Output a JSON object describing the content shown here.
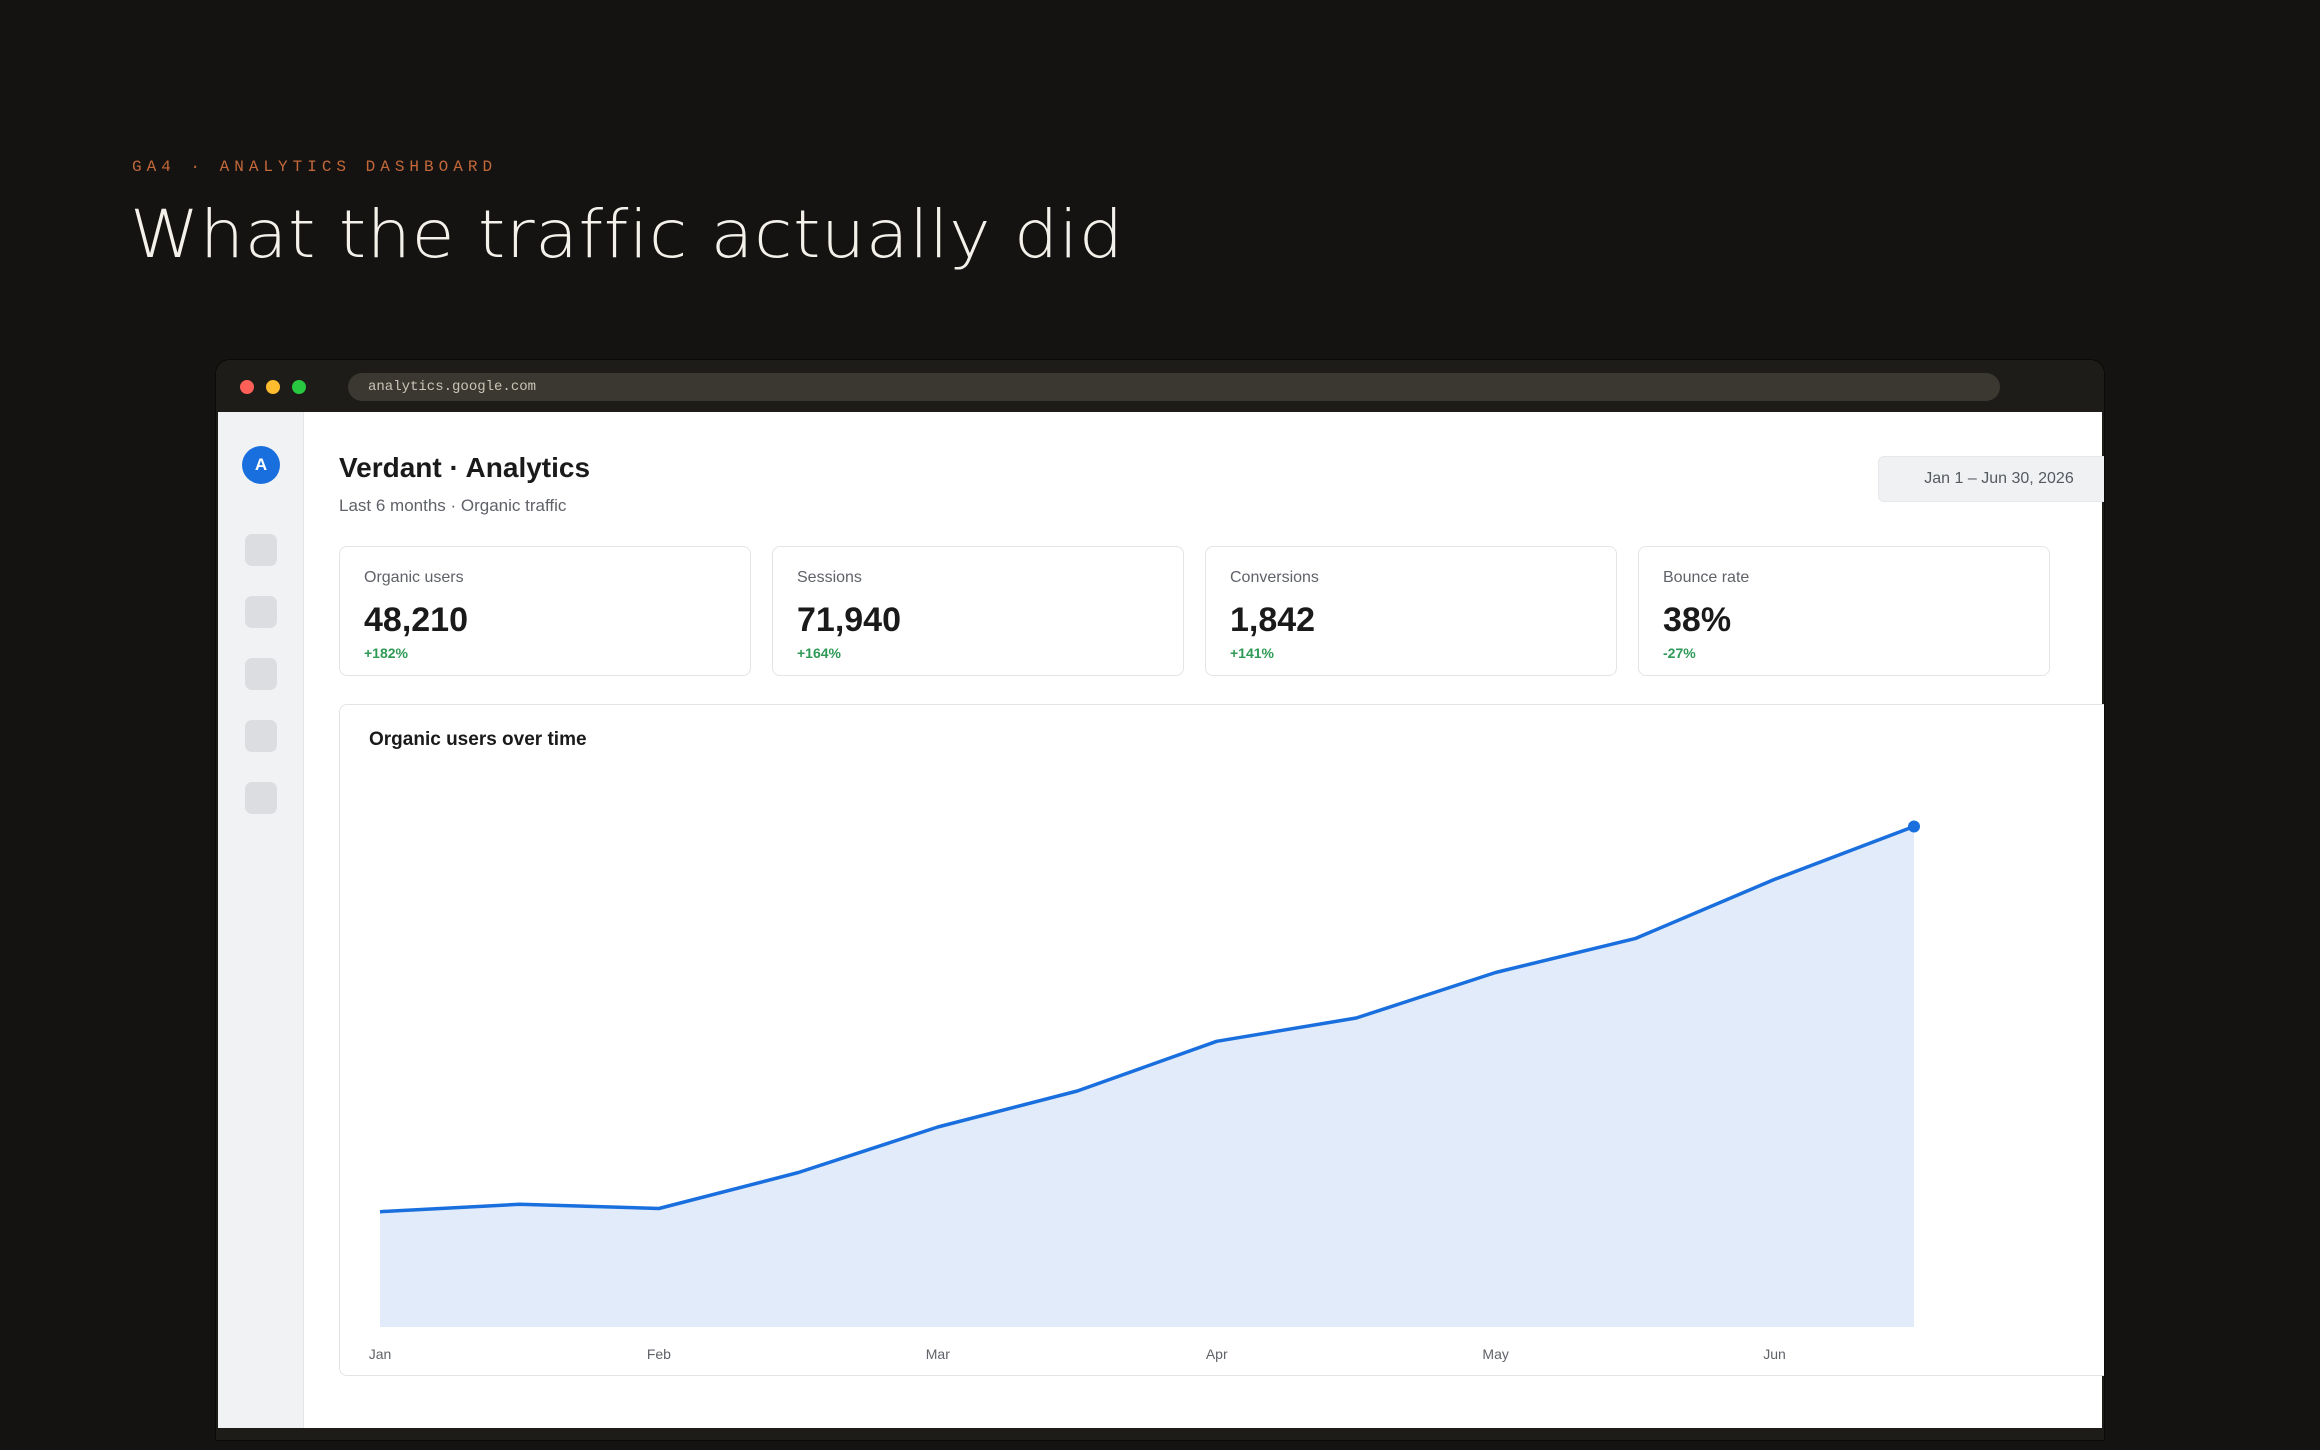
{
  "page": {
    "eyebrow": "GA4 · ANALYTICS DASHBOARD",
    "headline": "What the traffic actually did"
  },
  "browser": {
    "url": "analytics.google.com"
  },
  "sidebar": {
    "avatar_initial": "A"
  },
  "header": {
    "title": "Verdant · Analytics",
    "subtitle": "Last 6 months · Organic traffic",
    "date_range": "Jan 1 – Jun 30, 2026"
  },
  "kpis": [
    {
      "label": "Organic users",
      "value": "48,210",
      "delta": "+182%"
    },
    {
      "label": "Sessions",
      "value": "71,940",
      "delta": "+164%"
    },
    {
      "label": "Conversions",
      "value": "1,842",
      "delta": "+141%"
    },
    {
      "label": "Bounce rate",
      "value": "38%",
      "delta": "-27%"
    }
  ],
  "colors": {
    "accent": "#1a6fde",
    "area_fill": "#e2ebf9",
    "positive": "#2e9a56",
    "eyebrow": "#c4683a"
  },
  "chart_data": {
    "type": "area",
    "title": "Organic users over time",
    "xlabel": "",
    "ylabel": "",
    "categories": [
      "Jan",
      "Feb",
      "Mar",
      "Apr",
      "May",
      "Jun"
    ],
    "y_axis_shown": false,
    "grid": false,
    "legend": "none",
    "series": [
      {
        "values": [
          10.9,
          11.6,
          11.2,
          14.6,
          18.9,
          22.3,
          27.0,
          29.2,
          33.5,
          36.7,
          42.3,
          47.3
        ]
      }
    ],
    "ylim": [
      0,
      55
    ]
  }
}
